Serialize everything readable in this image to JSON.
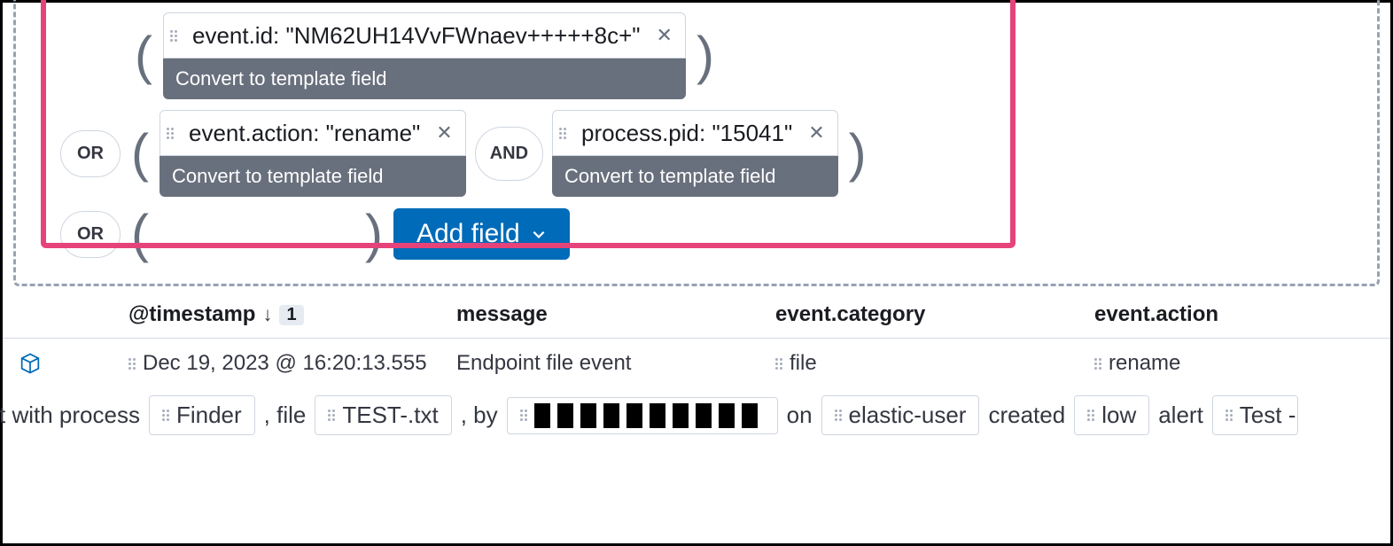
{
  "operators": {
    "or": "OR",
    "and": "AND"
  },
  "paren": {
    "open": "(",
    "close": ")"
  },
  "fields": [
    {
      "text": "event.id: \"NM62UH14VvFWnaev+++++8c+\"",
      "convertLabel": "Convert to template field"
    },
    {
      "text": "event.action: \"rename\"",
      "convertLabel": "Convert to template field"
    },
    {
      "text": "process.pid: \"15041\"",
      "convertLabel": "Convert to template field"
    }
  ],
  "addFieldLabel": "Add field",
  "table": {
    "headers": {
      "timestamp": "@timestamp",
      "sortBadge": "1",
      "message": "message",
      "category": "event.category",
      "action": "event.action"
    },
    "row": {
      "timestamp": "Dec 19, 2023 @ 16:20:13.555",
      "message": "Endpoint file event",
      "category": "file",
      "action": "rename"
    }
  },
  "sentence": {
    "prefix": "t with process",
    "process": "Finder",
    "sep1": ", file",
    "file": "TEST-.txt",
    "sep2": ", by",
    "sep3": "on",
    "host": "elastic-user",
    "sep4": "created",
    "severity": "low",
    "sep5": "alert",
    "ruleFragment": "Test -"
  }
}
